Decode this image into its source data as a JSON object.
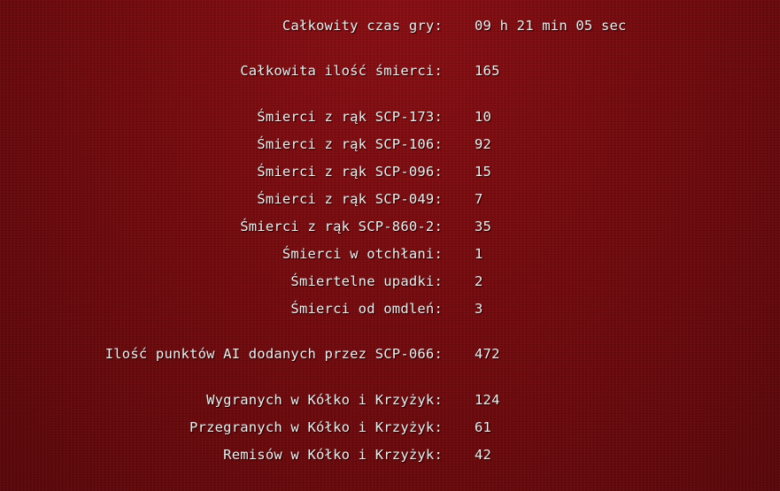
{
  "stats": {
    "total_time": {
      "label": "Całkowity czas gry:",
      "value": "09 h 21 min 05 sec"
    },
    "total_deaths": {
      "label": "Całkowita ilość śmierci:",
      "value": "165"
    },
    "deaths_173": {
      "label": "Śmierci z rąk SCP-173:",
      "value": "10"
    },
    "deaths_106": {
      "label": "Śmierci z rąk SCP-106:",
      "value": "92"
    },
    "deaths_096": {
      "label": "Śmierci z rąk SCP-096:",
      "value": "15"
    },
    "deaths_049": {
      "label": "Śmierci z rąk SCP-049:",
      "value": "7"
    },
    "deaths_860": {
      "label": "Śmierci z rąk SCP-860-2:",
      "value": "35"
    },
    "deaths_abyss": {
      "label": "Śmierci w otchłani:",
      "value": "1"
    },
    "deaths_falls": {
      "label": "Śmiertelne upadki:",
      "value": "2"
    },
    "deaths_faint": {
      "label": "Śmierci od omdleń:",
      "value": "3"
    },
    "ai_points_066": {
      "label": "Ilość punktów AI dodanych przez SCP-066:",
      "value": "472"
    },
    "ttt_wins": {
      "label": "Wygranych w Kółko i Krzyżyk:",
      "value": "124"
    },
    "ttt_losses": {
      "label": "Przegranych w Kółko i Krzyżyk:",
      "value": "61"
    },
    "ttt_draws": {
      "label": "Remisów w Kółko i Krzyżyk:",
      "value": "42"
    }
  }
}
